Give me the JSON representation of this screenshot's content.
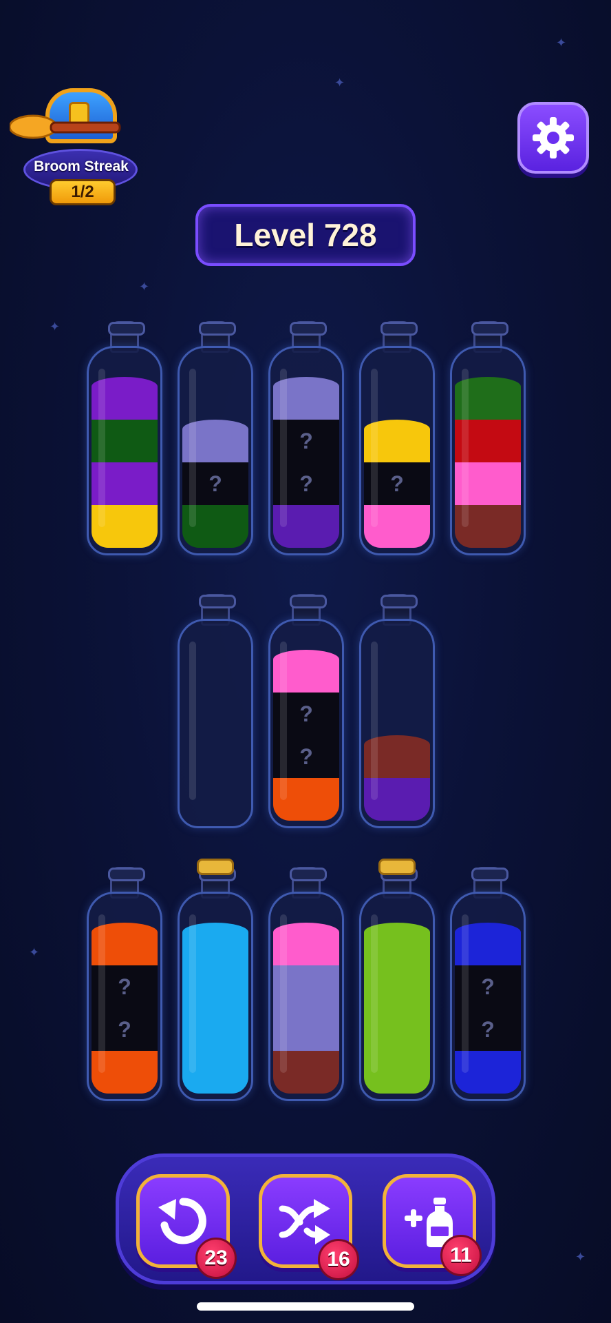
{
  "streak": {
    "label": "Broom Streak",
    "count": "1/2",
    "icon": "treasure-chest-broom-icon"
  },
  "settings": {
    "icon": "gear-icon"
  },
  "level": {
    "title": "Level 728"
  },
  "colors": {
    "purple": "#7a1cc8",
    "dark_green": "#0f5a14",
    "yellow": "#f7c70c",
    "lavender": "#7a74c8",
    "black": "#0a0a14",
    "pink": "#ff5ccc",
    "green": "#1f6e1a",
    "red": "#c40a12",
    "maroon": "#7a2a26",
    "orange": "#ee4e08",
    "cyan": "#1aaaf0",
    "lime": "#76c01e",
    "blue": "#1c24d8",
    "dark_purple": "#5a1cb0"
  },
  "bottles": [
    {
      "row": 1,
      "layers": [
        "yellow",
        "purple",
        "dark_green",
        "purple"
      ],
      "hidden": [
        false,
        false,
        false,
        false
      ],
      "corked": false
    },
    {
      "row": 1,
      "layers": [
        "dark_green",
        "black",
        "lavender"
      ],
      "hidden": [
        false,
        true,
        false
      ],
      "corked": false
    },
    {
      "row": 1,
      "layers": [
        "dark_purple",
        "black",
        "black",
        "lavender"
      ],
      "hidden": [
        false,
        true,
        true,
        false
      ],
      "corked": false
    },
    {
      "row": 1,
      "layers": [
        "pink",
        "black",
        "yellow"
      ],
      "hidden": [
        false,
        true,
        false
      ],
      "corked": false
    },
    {
      "row": 1,
      "layers": [
        "maroon",
        "pink",
        "red",
        "green"
      ],
      "hidden": [
        false,
        false,
        false,
        false
      ],
      "corked": false
    },
    {
      "row": 2,
      "layers": [],
      "hidden": [],
      "corked": false
    },
    {
      "row": 2,
      "layers": [
        "orange",
        "black",
        "black",
        "pink"
      ],
      "hidden": [
        false,
        true,
        true,
        false
      ],
      "corked": false
    },
    {
      "row": 2,
      "layers": [
        "dark_purple",
        "maroon"
      ],
      "hidden": [
        false,
        false
      ],
      "corked": false
    },
    {
      "row": 3,
      "layers": [
        "orange",
        "black",
        "black",
        "orange"
      ],
      "hidden": [
        false,
        true,
        true,
        false
      ],
      "corked": false
    },
    {
      "row": 3,
      "layers": [
        "cyan",
        "cyan",
        "cyan",
        "cyan"
      ],
      "hidden": [
        false,
        false,
        false,
        false
      ],
      "corked": true
    },
    {
      "row": 3,
      "layers": [
        "maroon",
        "lavender",
        "lavender",
        "pink"
      ],
      "hidden": [
        false,
        false,
        false,
        false
      ],
      "corked": false
    },
    {
      "row": 3,
      "layers": [
        "lime",
        "lime",
        "lime",
        "lime"
      ],
      "hidden": [
        false,
        false,
        false,
        false
      ],
      "corked": true
    },
    {
      "row": 3,
      "layers": [
        "blue",
        "black",
        "black",
        "blue"
      ],
      "hidden": [
        false,
        true,
        true,
        false
      ],
      "corked": false
    }
  ],
  "hidden_marker": "?",
  "tools": [
    {
      "name": "undo",
      "icon": "undo-arrow-icon",
      "count": "23"
    },
    {
      "name": "shuffle",
      "icon": "shuffle-icon",
      "count": "16"
    },
    {
      "name": "add-bottle",
      "icon": "add-bottle-icon",
      "count": "11"
    }
  ]
}
